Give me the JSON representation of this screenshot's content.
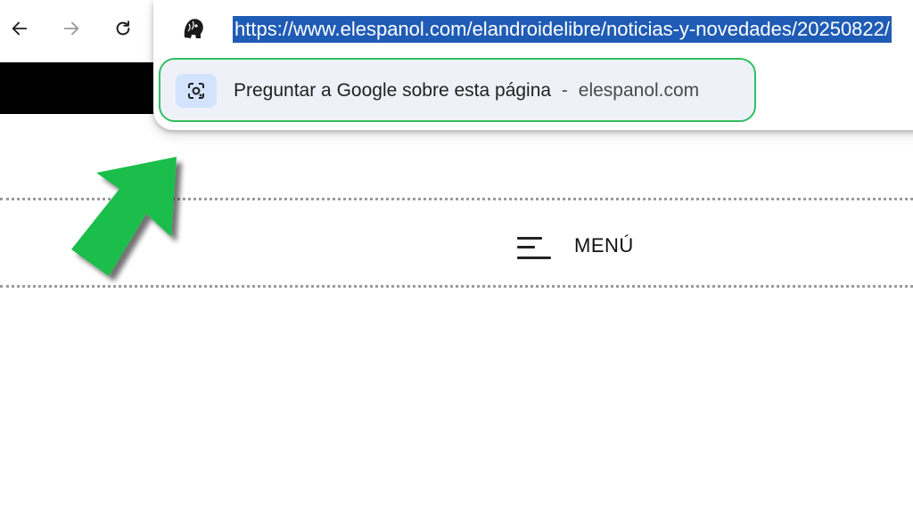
{
  "browser": {
    "url": "https://www.elespanol.com/elandroidelibre/noticias-y-novedades/20250822/",
    "icons": {
      "back": "arrow-left-icon",
      "forward": "arrow-right-icon",
      "reload": "reload-icon",
      "site": "lion-logo-icon"
    }
  },
  "suggestion": {
    "text": "Preguntar a Google sobre esta página",
    "separator": "-",
    "domain": "elespanol.com",
    "icon": "google-lens-icon",
    "highlight_color": "#2fbf5f"
  },
  "page": {
    "menu_label": "MENÚ",
    "menu_icon": "hamburger-icon"
  },
  "annotation": {
    "arrow_color": "#1fbe4b"
  }
}
